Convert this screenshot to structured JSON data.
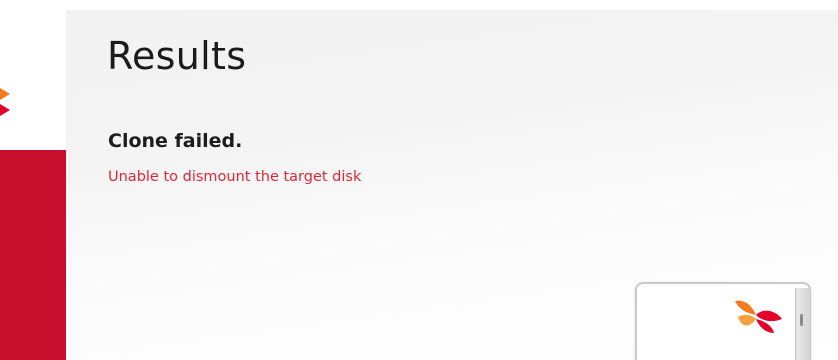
{
  "window": {
    "title": "Results"
  },
  "result": {
    "heading": "Clone failed.",
    "message": "Unable to dismount the target disk"
  },
  "colors": {
    "brand_red": "#c8102e",
    "error_text": "#e32636",
    "logo_orange": "#f47b20",
    "logo_red": "#e4002b"
  },
  "icons": {
    "sidebar_logo": "brand-logo-fragment-icon",
    "device": "ssd-drive-icon",
    "device_logo": "sk-hynix-butterfly-icon"
  }
}
